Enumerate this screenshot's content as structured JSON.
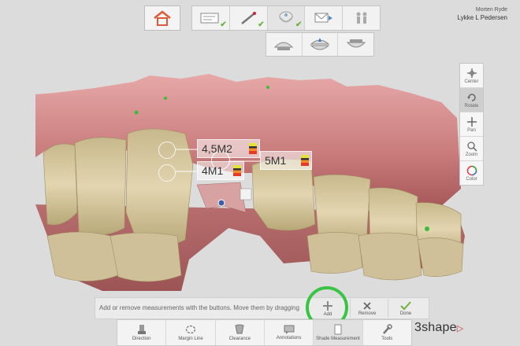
{
  "header": {
    "operator": "Morten Ryde",
    "patient": "Lykke L Pedersen"
  },
  "workflow": {
    "home_icon": "house-icon",
    "steps": [
      "order-form-icon",
      "scan-pen-icon",
      "scan-jaw-icon",
      "send-icon",
      "people-icon"
    ],
    "sub_steps": [
      "upper-jaw-icon",
      "bite-icon",
      "lower-jaw-icon"
    ]
  },
  "right_toolbar": {
    "items": [
      {
        "label": "Center",
        "icon": "center-icon"
      },
      {
        "label": "Rotate",
        "icon": "rotate-icon"
      },
      {
        "label": "Pan",
        "icon": "pan-icon"
      },
      {
        "label": "Zoom",
        "icon": "zoom-icon"
      },
      {
        "label": "Color",
        "icon": "color-wheel-icon"
      }
    ]
  },
  "measurements": [
    {
      "label": "4,5M2"
    },
    {
      "label": "4M1"
    },
    {
      "label": "5M1"
    }
  ],
  "instruction": "Add or remove measurements with the buttons. Move them by dragging",
  "actions": {
    "add": "Add",
    "remove": "Remove",
    "done": "Done"
  },
  "tools": [
    {
      "label": "Direction",
      "icon": "direction-icon"
    },
    {
      "label": "Margin Line",
      "icon": "margin-line-icon"
    },
    {
      "label": "Clearance",
      "icon": "clearance-icon"
    },
    {
      "label": "Annotations",
      "icon": "annotations-icon"
    },
    {
      "label": "Shade Measurement",
      "icon": "shade-measurement-icon"
    },
    {
      "label": "Tools",
      "icon": "wrench-icon"
    }
  ],
  "brand": "3shape",
  "colors": {
    "accent_green": "#39c443",
    "check_green": "#6db33f",
    "gum": "#c97c7c",
    "tooth": "#d9c9a0"
  }
}
